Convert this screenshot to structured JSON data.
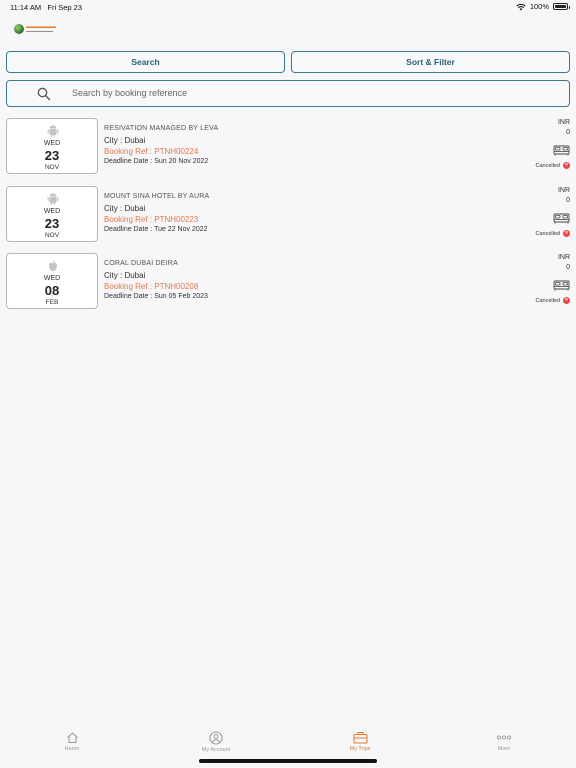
{
  "status_bar": {
    "time": "11:14 AM",
    "date": "Fri Sep 23",
    "battery": "100%",
    "battery_level": 1.0
  },
  "actions": {
    "search_label": "Search",
    "sort_filter_label": "Sort & Filter"
  },
  "search": {
    "placeholder": "Search by booking reference"
  },
  "trips": [
    {
      "os_icon": "android-icon",
      "dow": "WED",
      "day": "23",
      "month": "NOV",
      "hotel": "RESIVATION MANAGED BY LEVA",
      "city": "City : Dubai",
      "booking_ref": "Booking Ref : PTNH00224",
      "deadline": "Deadline Date : Sun 20 Nov 2022",
      "currency": "INR",
      "amount": "0",
      "status": "Cancelled"
    },
    {
      "os_icon": "android-icon",
      "dow": "WED",
      "day": "23",
      "month": "NOV",
      "hotel": "MOUNT SINA HOTEL BY AURA",
      "city": "City : Dubai",
      "booking_ref": "Booking Ref : PTNH00223",
      "deadline": "Deadline Date : Tue 22 Nov 2022",
      "currency": "INR",
      "amount": "0",
      "status": "Cancelled"
    },
    {
      "os_icon": "apple-icon",
      "dow": "WED",
      "day": "08",
      "month": "FEB",
      "hotel": "CORAL DUBAI DEIRA",
      "city": "City : Dubai",
      "booking_ref": "Booking Ref : PTNH00208",
      "deadline": "Deadline Date : Sun 05 Feb 2023",
      "currency": "INR",
      "amount": "0",
      "status": "Cancelled"
    }
  ],
  "tabs": [
    {
      "label": "Home",
      "icon": "home-icon"
    },
    {
      "label": "My Account",
      "icon": "account-icon"
    },
    {
      "label": "My Trips",
      "icon": "briefcase-icon",
      "active": true
    },
    {
      "label": "More",
      "icon": "more-icon"
    }
  ],
  "colors": {
    "accent": "#3e7a8f",
    "booking_ref": "#e07a4a",
    "cancelled": "#e24a4a",
    "active_tab": "#e07a2a"
  }
}
